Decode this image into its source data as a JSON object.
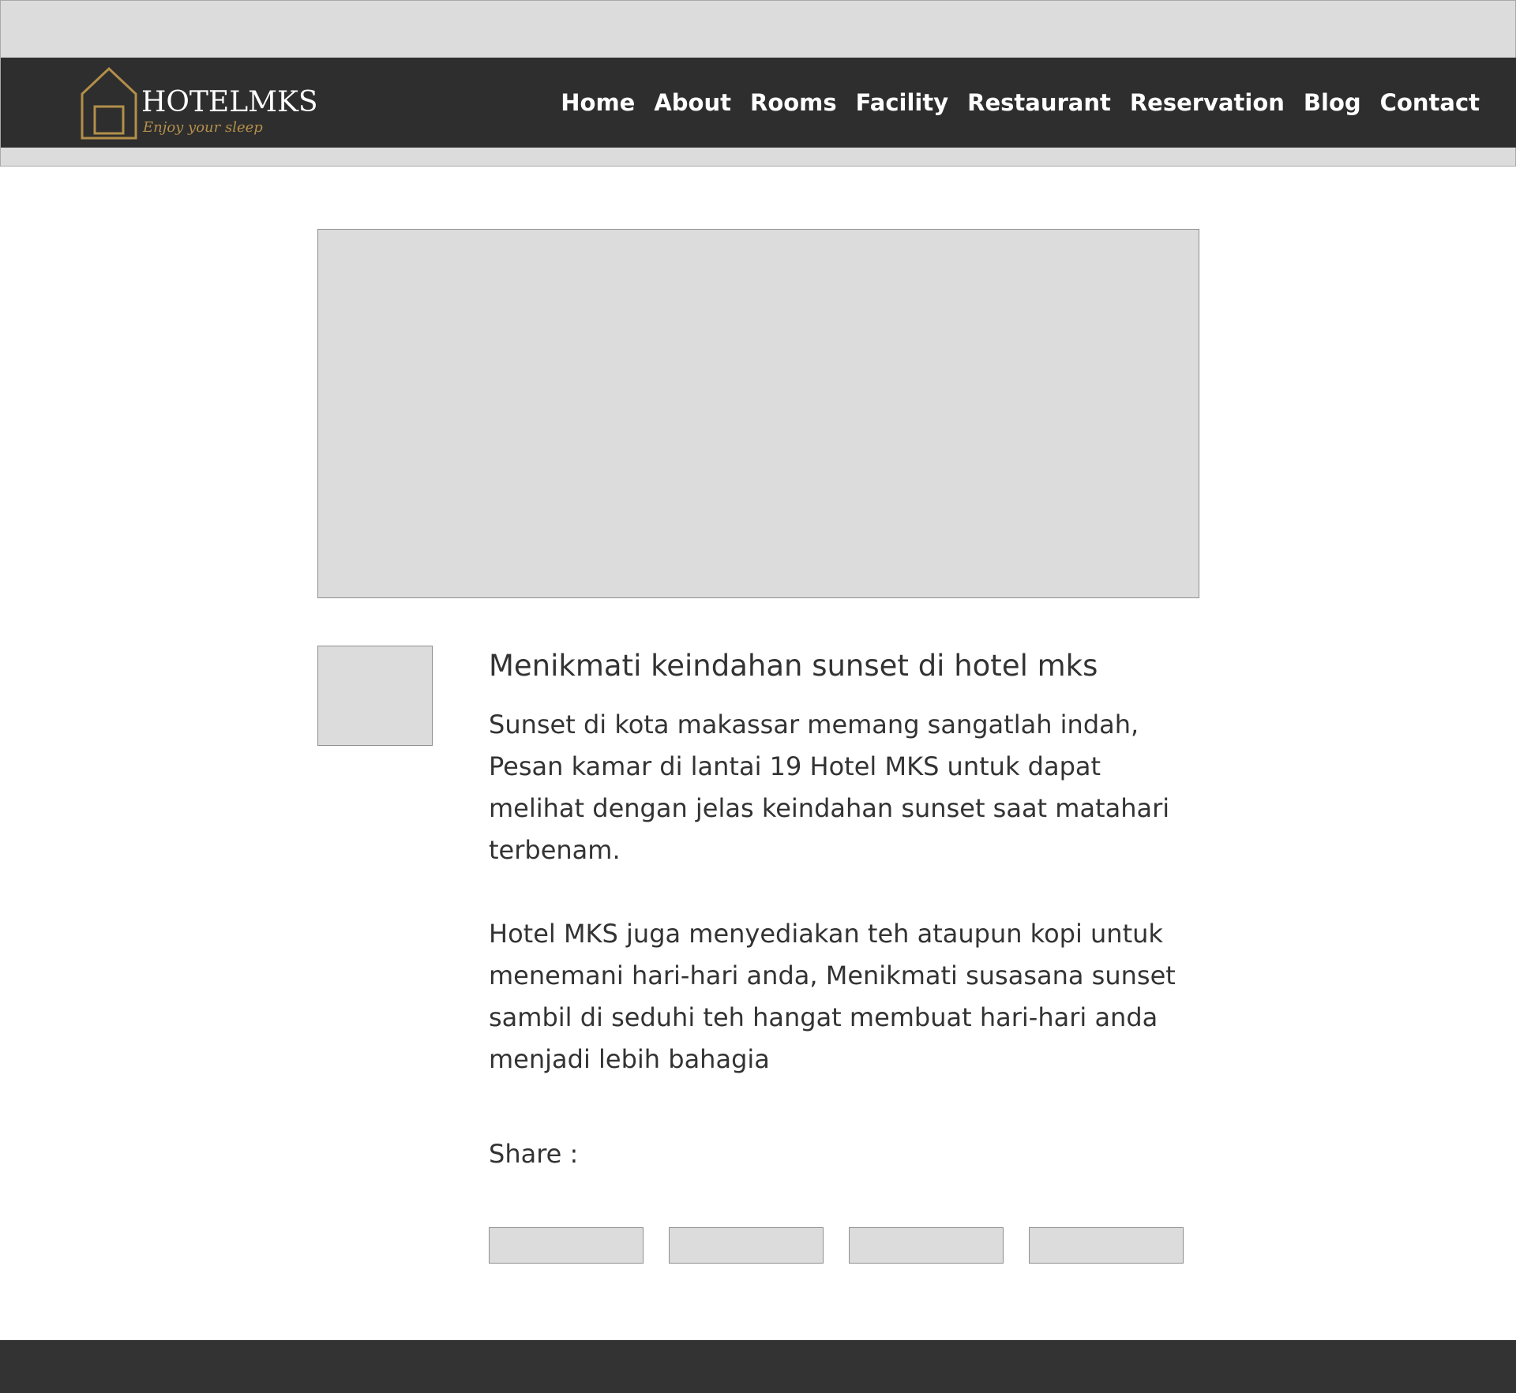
{
  "brand": {
    "name": "HOTELMKS",
    "tagline": "Enjoy your sleep",
    "accent_color": "#b38f4a"
  },
  "nav": {
    "items": [
      {
        "label": "Home"
      },
      {
        "label": "About"
      },
      {
        "label": "Rooms"
      },
      {
        "label": "Facility"
      },
      {
        "label": "Restaurant"
      },
      {
        "label": "Reservation"
      },
      {
        "label": "Blog"
      },
      {
        "label": "Contact"
      }
    ]
  },
  "post": {
    "title": "Menikmati keindahan sunset di hotel mks",
    "paragraphs": [
      "Sunset di kota makassar memang sangatlah indah, Pesan kamar di lantai 19 Hotel MKS untuk dapat melihat dengan jelas keindahan sunset saat matahari terbenam.",
      "Hotel MKS juga menyediakan teh ataupun kopi untuk menemani hari-hari anda, Menikmati susasana sunset sambil di seduhi teh hangat membuat hari-hari anda menjadi lebih bahagia"
    ],
    "share_label": "Share :"
  },
  "colors": {
    "navbar_bg": "#2e2e2e",
    "placeholder_bg": "#dcdcdc",
    "footer_bg": "#333333",
    "text": "#333333"
  }
}
